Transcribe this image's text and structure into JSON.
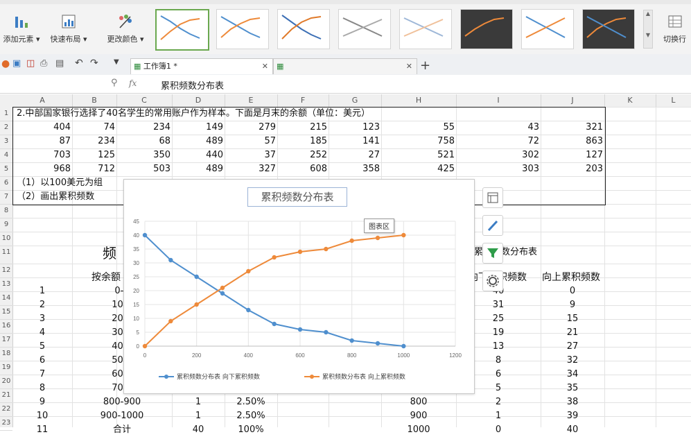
{
  "ribbon": {
    "add_element": "添加元素",
    "quick_layout": "快速布局",
    "change_color": "更改颜色",
    "switch_rowcol": "切换行"
  },
  "tabs": {
    "workbook1": "工作簿1 *"
  },
  "formula": {
    "fx": "fx",
    "value": "累积频数分布表"
  },
  "columns": [
    "A",
    "B",
    "C",
    "D",
    "E",
    "F",
    "G",
    "H",
    "I",
    "J",
    "K",
    "L"
  ],
  "rows": [
    "1",
    "2",
    "3",
    "4",
    "5",
    "6",
    "7",
    "8",
    "9",
    "10",
    "11",
    "12",
    "13",
    "14",
    "15",
    "16",
    "17",
    "18",
    "19",
    "20",
    "21",
    "22",
    "23"
  ],
  "sheet": {
    "r1": "2.中部国家银行选择了40名学生的常用账户作为样本。下面是月末的余额（单位：美元）",
    "data": [
      [
        "404",
        "74",
        "234",
        "149",
        "279",
        "215",
        "123",
        "55",
        "43",
        "321"
      ],
      [
        "87",
        "234",
        "68",
        "489",
        "57",
        "185",
        "141",
        "758",
        "72",
        "863"
      ],
      [
        "703",
        "125",
        "350",
        "440",
        "37",
        "252",
        "27",
        "521",
        "302",
        "127"
      ],
      [
        "968",
        "712",
        "503",
        "489",
        "327",
        "608",
        "358",
        "425",
        "303",
        "203"
      ]
    ],
    "r6": "（1）以100美元为组",
    "r7": "（2）画出累积频数",
    "table_title_left": "频",
    "table_title_right": "累积频数分布表",
    "col_b_header": "按余额",
    "col_i_header": "向下累积频数",
    "col_j_header": "向上累积频数",
    "rows13": [
      {
        "a": "1",
        "b": "0-1"
      },
      {
        "a": "2",
        "b": "100-"
      },
      {
        "a": "3",
        "b": "200-"
      },
      {
        "a": "4",
        "b": "300-"
      },
      {
        "a": "5",
        "b": "400-"
      },
      {
        "a": "6",
        "b": "500-"
      },
      {
        "a": "7",
        "b": "600-"
      },
      {
        "a": "8",
        "b": "700-"
      },
      {
        "a": "9",
        "b": "800-900",
        "d": "1",
        "e": "2.50%",
        "h": "800"
      },
      {
        "a": "10",
        "b": "900-1000",
        "d": "1",
        "e": "2.50%",
        "h": "900"
      },
      {
        "a": "11",
        "b": "合计",
        "d": "40",
        "e": "100%",
        "h": "1000"
      }
    ],
    "down_cum": [
      "40",
      "31",
      "25",
      "19",
      "13",
      "8",
      "6",
      "5",
      "2",
      "1",
      "0"
    ],
    "up_cum": [
      "0",
      "9",
      "15",
      "21",
      "27",
      "32",
      "34",
      "35",
      "38",
      "39",
      "40"
    ]
  },
  "chart_data": {
    "type": "line",
    "title": "累积频数分布表",
    "tooltip": "图表区",
    "x": [
      0,
      100,
      200,
      300,
      400,
      500,
      600,
      700,
      800,
      900,
      1000
    ],
    "xlim": [
      0,
      1200
    ],
    "xticks": [
      0,
      200,
      400,
      600,
      800,
      1000,
      1200
    ],
    "ylim": [
      0,
      45
    ],
    "yticks": [
      0,
      5,
      10,
      15,
      20,
      25,
      30,
      35,
      40,
      45
    ],
    "grid": true,
    "legend_position": "bottom",
    "series": [
      {
        "name": "累积频数分布表 向下累积频数",
        "color": "#4f8fce",
        "values": [
          40,
          31,
          25,
          19,
          13,
          8,
          6,
          5,
          2,
          1,
          0
        ]
      },
      {
        "name": "累积频数分布表 向上累积频数",
        "color": "#ee8a3a",
        "values": [
          0,
          9,
          15,
          21,
          27,
          32,
          34,
          35,
          38,
          39,
          40
        ]
      }
    ]
  }
}
